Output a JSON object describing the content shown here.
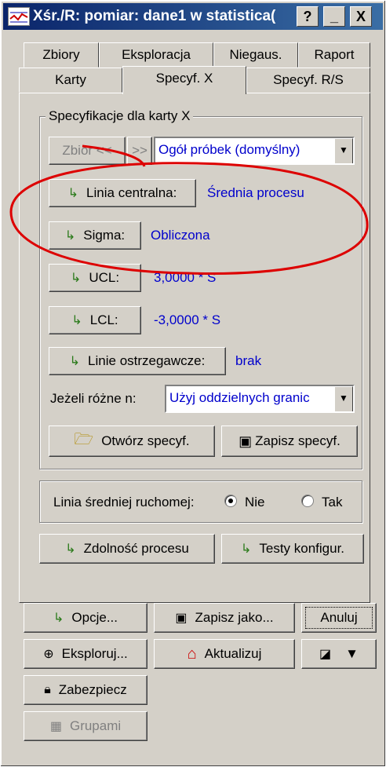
{
  "window": {
    "title": "Xśr./R: pomiar: dane1 w statistica(",
    "help_btn": "?",
    "min_btn": "_",
    "close_btn": "X"
  },
  "tabs_row1": [
    "Zbiory",
    "Eksploracja",
    "Niegaus.",
    "Raport"
  ],
  "tabs_row2": [
    "Karty",
    "Specyf. X",
    "Specyf. R/S"
  ],
  "active_tab": "Specyf. X",
  "spec_group": {
    "legend": "Specyfikacje dla karty X",
    "zbior_btn": "Zbiór <<",
    "arrow_btn": ">>",
    "sample_combo": "Ogół próbek (domyślny)",
    "center_line_btn": "Linia centralna:",
    "center_line_val": "Średnia procesu",
    "sigma_btn": "Sigma:",
    "sigma_val": "Obliczona",
    "ucl_btn": "UCL:",
    "ucl_val": "3,0000 * S",
    "lcl_btn": "LCL:",
    "lcl_val": "-3,0000 * S",
    "warning_btn": "Linie ostrzegawcze:",
    "warning_val": "brak",
    "if_diff_label": "Jeżeli różne n:",
    "if_diff_combo": "Użyj oddzielnych granic",
    "open_spec_btn": "Otwórz specyf.",
    "save_spec_btn": "Zapisz specyf."
  },
  "moving_avg": {
    "label": "Linia średniej ruchomej:",
    "opt_no": "Nie",
    "opt_yes": "Tak",
    "selected": "Nie"
  },
  "capability_btn": "Zdolność procesu",
  "tests_btn": "Testy konfigur.",
  "bottom": {
    "options_btn": "Opcje...",
    "save_as_btn": "Zapisz jako...",
    "cancel_btn": "Anuluj",
    "explore_btn": "Eksploruj...",
    "update_btn": "Aktualizuj",
    "secure_btn": "Zabezpiecz",
    "groups_btn": "Grupami"
  },
  "colors": {
    "title_start": "#0a246a",
    "title_end": "#3a6ea5",
    "value_text": "#0000cc",
    "annotation": "#dd0000"
  }
}
